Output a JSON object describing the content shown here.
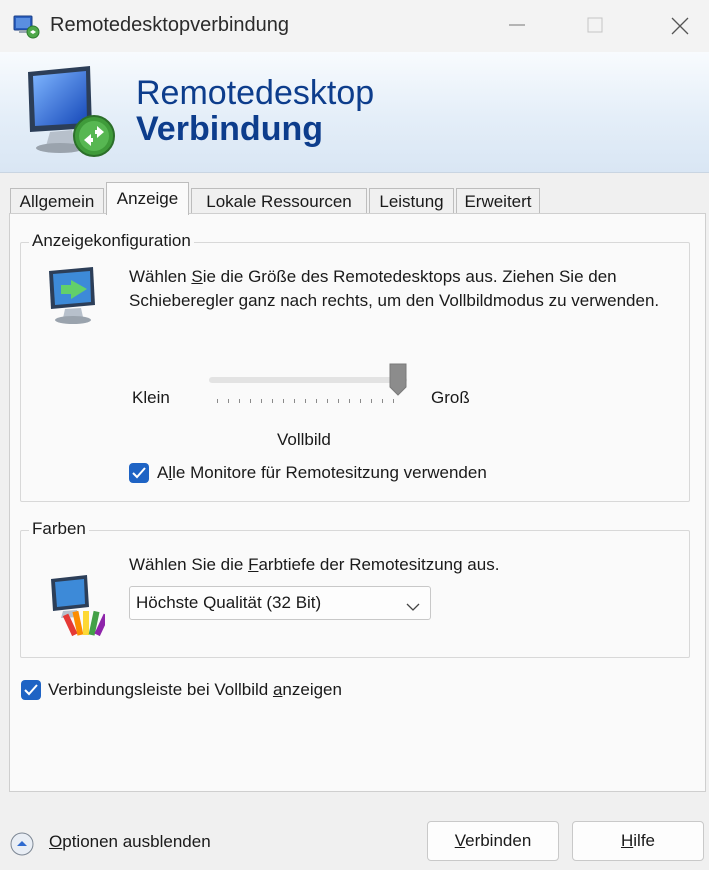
{
  "window": {
    "title": "Remotedesktopverbindung"
  },
  "banner": {
    "line1": "Remotedesktop",
    "line2": "Verbindung"
  },
  "tabs": [
    {
      "label": "Allgemein",
      "active": false
    },
    {
      "label": "Anzeige",
      "active": true
    },
    {
      "label": "Lokale Ressourcen",
      "active": false
    },
    {
      "label": "Leistung",
      "active": false
    },
    {
      "label": "Erweitert",
      "active": false
    }
  ],
  "display_config": {
    "legend": "Anzeigekonfiguration",
    "desc_pre": "Wählen ",
    "desc_mnemonic": "S",
    "desc_post": "ie die Größe des Remotedesktops aus. Ziehen Sie den Schieberegler ganz nach rechts, um den Vollbildmodus zu verwenden.",
    "slider_min_label": "Klein",
    "slider_max_label": "Groß",
    "slider_value_label": "Vollbild",
    "slider_position": 1.0,
    "all_monitors": {
      "checked": true,
      "pre": "A",
      "mnemonic": "l",
      "post": "le Monitore für Remotesitzung verwenden"
    }
  },
  "colors": {
    "legend": "Farben",
    "desc_pre": "Wählen Sie die ",
    "desc_mnemonic": "F",
    "desc_post": "arbtiefe der Remotesitzung aus.",
    "selected": "Höchste Qualität (32 Bit)"
  },
  "connection_bar": {
    "checked": true,
    "pre": "Verbindungsleiste bei Vollbild ",
    "mnemonic": "a",
    "post": "nzeigen"
  },
  "footer": {
    "options_mnemonic": "O",
    "options_rest": "ptionen ausblenden",
    "connect_mnemonic": "V",
    "connect_rest": "erbinden",
    "help_mnemonic": "H",
    "help_rest": "ilfe"
  },
  "accent": "#1e63c4",
  "brand_text": "#0d3d8c"
}
